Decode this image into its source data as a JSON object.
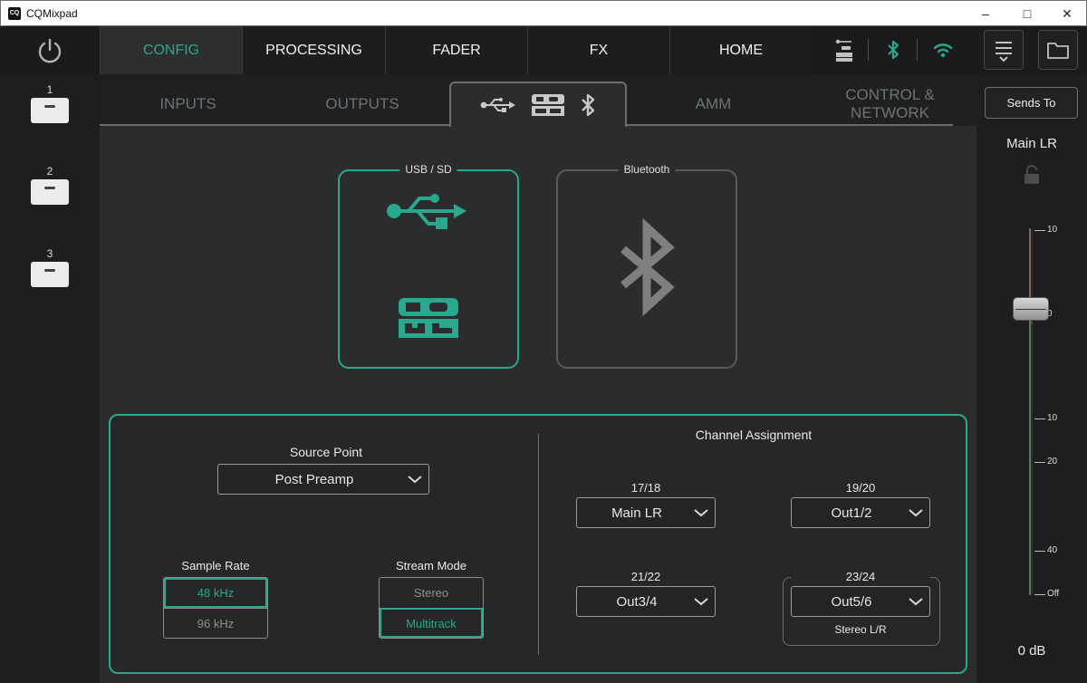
{
  "window": {
    "app_icon": "CQ",
    "title": "CQMixpad",
    "min": "–",
    "max": "□",
    "close": "✕"
  },
  "nav": {
    "tabs": [
      "CONFIG",
      "PROCESSING",
      "FADER",
      "FX",
      "HOME"
    ],
    "active": "CONFIG",
    "accent": "#29a88d"
  },
  "slots": [
    "1",
    "2",
    "3"
  ],
  "subtabs": {
    "inputs": "INPUTS",
    "outputs": "OUTPUTS",
    "amm": "AMM",
    "control_line1": "CONTROL &",
    "control_line2": "NETWORK"
  },
  "devices": {
    "usb_sd": "USB / SD",
    "bluetooth": "Bluetooth"
  },
  "source": {
    "label": "Source Point",
    "value": "Post Preamp"
  },
  "sample_rate": {
    "label": "Sample Rate",
    "options": [
      "48 kHz",
      "96 kHz"
    ],
    "selected": "48 kHz"
  },
  "stream_mode": {
    "label": "Stream Mode",
    "options": [
      "Stereo",
      "Multitrack"
    ],
    "selected": "Multitrack"
  },
  "channel_assignment": {
    "title": "Channel Assignment",
    "pairs": [
      {
        "label": "17/18",
        "value": "Main LR"
      },
      {
        "label": "19/20",
        "value": "Out1/2"
      },
      {
        "label": "21/22",
        "value": "Out3/4"
      },
      {
        "label": "23/24",
        "value": "Out5/6"
      }
    ],
    "stereo_note": "Stereo L/R"
  },
  "fader": {
    "sends_to": "Sends To",
    "bus": "Main LR",
    "scale": [
      "10",
      "0",
      "10",
      "20",
      "40",
      "Off"
    ],
    "level": "0 dB"
  }
}
